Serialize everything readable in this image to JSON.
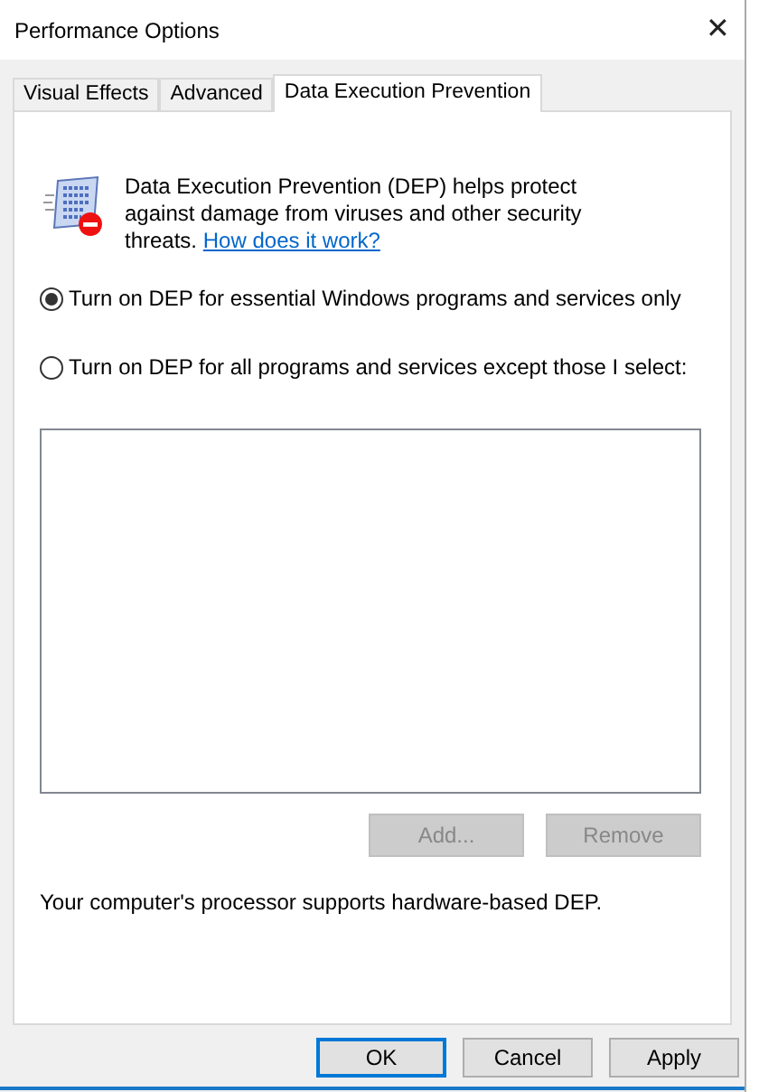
{
  "window": {
    "title": "Performance Options",
    "close": "✕"
  },
  "tabs": [
    {
      "label": "Visual Effects",
      "selected": false
    },
    {
      "label": "Advanced",
      "selected": false
    },
    {
      "label": "Data Execution Prevention",
      "selected": true
    }
  ],
  "description": {
    "text": "Data Execution Prevention (DEP) helps protect against damage from viruses and other security threats.",
    "link": "How does it work?"
  },
  "options": [
    {
      "label": "Turn on DEP for essential Windows programs and services only",
      "selected": true
    },
    {
      "label": "Turn on DEP for all programs and services except those I select:",
      "selected": false
    }
  ],
  "list_buttons": [
    {
      "label": "Add...",
      "disabled": true
    },
    {
      "label": "Remove",
      "disabled": true
    }
  ],
  "status": "Your computer's processor supports hardware-based DEP.",
  "buttons": [
    {
      "label": "OK",
      "default": true
    },
    {
      "label": "Cancel",
      "default": false
    },
    {
      "label": "Apply",
      "default": false
    }
  ]
}
